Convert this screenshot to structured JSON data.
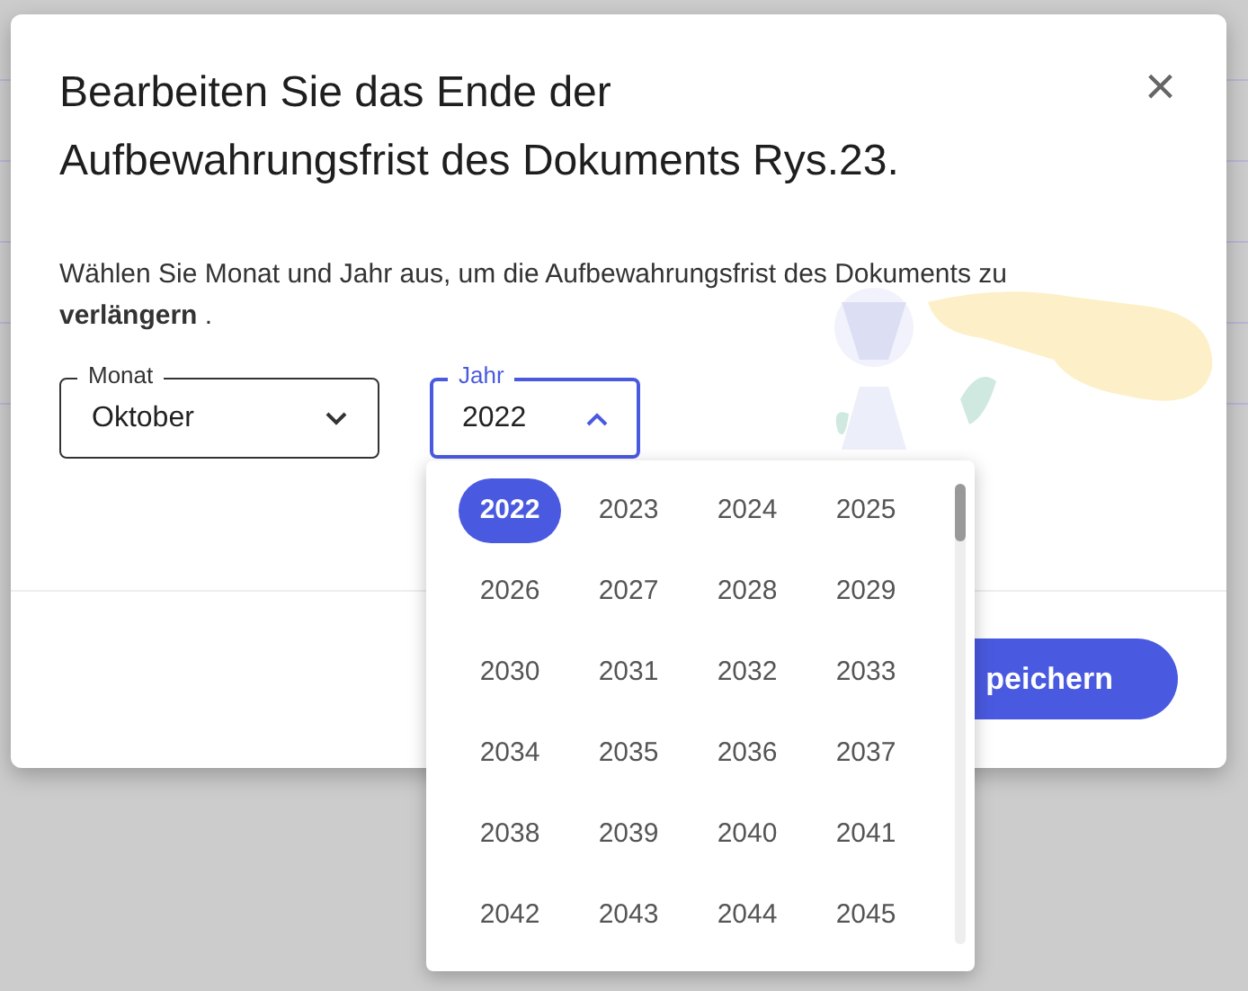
{
  "dialog": {
    "title": "Bearbeiten Sie das Ende der Aufbewahrungsfrist des Dokuments Rys.23.",
    "close": "×",
    "description": "Wählen Sie Monat und Jahr aus, um die Aufbewahrungsfrist des Dokuments zu **verlängern** .",
    "month_field": {
      "label": "Monat",
      "value": "Oktober",
      "expanded": false
    },
    "year_field": {
      "label": "Jahr",
      "value": "2022",
      "expanded": true
    },
    "year_options": [
      {
        "label": "2022",
        "selected": true
      },
      {
        "label": "2023",
        "selected": false
      },
      {
        "label": "2024",
        "selected": false
      },
      {
        "label": "2025",
        "selected": false
      },
      {
        "label": "2026",
        "selected": false
      },
      {
        "label": "2027",
        "selected": false
      },
      {
        "label": "2028",
        "selected": false
      },
      {
        "label": "2029",
        "selected": false
      },
      {
        "label": "2030",
        "selected": false
      },
      {
        "label": "2031",
        "selected": false
      },
      {
        "label": "2032",
        "selected": false
      },
      {
        "label": "2033",
        "selected": false
      },
      {
        "label": "2034",
        "selected": false
      },
      {
        "label": "2035",
        "selected": false
      },
      {
        "label": "2036",
        "selected": false
      },
      {
        "label": "2037",
        "selected": false
      },
      {
        "label": "2038",
        "selected": false
      },
      {
        "label": "2039",
        "selected": false
      },
      {
        "label": "2040",
        "selected": false
      },
      {
        "label": "2041",
        "selected": false
      },
      {
        "label": "2042",
        "selected": false
      },
      {
        "label": "2043",
        "selected": false
      },
      {
        "label": "2044",
        "selected": false
      },
      {
        "label": "2045",
        "selected": false
      }
    ],
    "save_button": "peichern"
  }
}
